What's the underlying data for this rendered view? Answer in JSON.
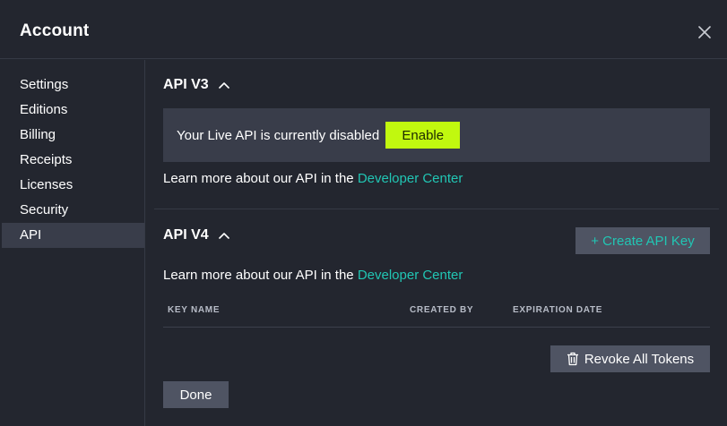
{
  "window": {
    "title": "Account"
  },
  "sidebar": {
    "items": [
      {
        "label": "Settings"
      },
      {
        "label": "Editions"
      },
      {
        "label": "Billing"
      },
      {
        "label": "Receipts"
      },
      {
        "label": "Licenses"
      },
      {
        "label": "Security"
      },
      {
        "label": "API",
        "active": true
      }
    ]
  },
  "api_v3": {
    "title": "API V3",
    "status_text": "Your Live API is currently disabled",
    "enable_label": "Enable",
    "learn_prefix": "Learn more about our API in the ",
    "learn_link": "Developer Center"
  },
  "api_v4": {
    "title": "API V4",
    "create_label": "+ Create API Key",
    "learn_prefix": "Learn more about our API in the ",
    "learn_link": "Developer Center",
    "table": {
      "columns": [
        "KEY NAME",
        "CREATED BY",
        "EXPIRATION DATE"
      ],
      "rows": []
    },
    "revoke_label": "Revoke All Tokens"
  },
  "footer": {
    "done_label": "Done"
  },
  "colors": {
    "background": "#23262f",
    "panel": "#393d4a",
    "button": "#4f5463",
    "accent_lime": "#c1f80f",
    "link_teal": "#21c6b4"
  },
  "icons": {
    "close": "close-icon",
    "collapse": "chevron-up-icon",
    "revoke": "trash-icon"
  }
}
